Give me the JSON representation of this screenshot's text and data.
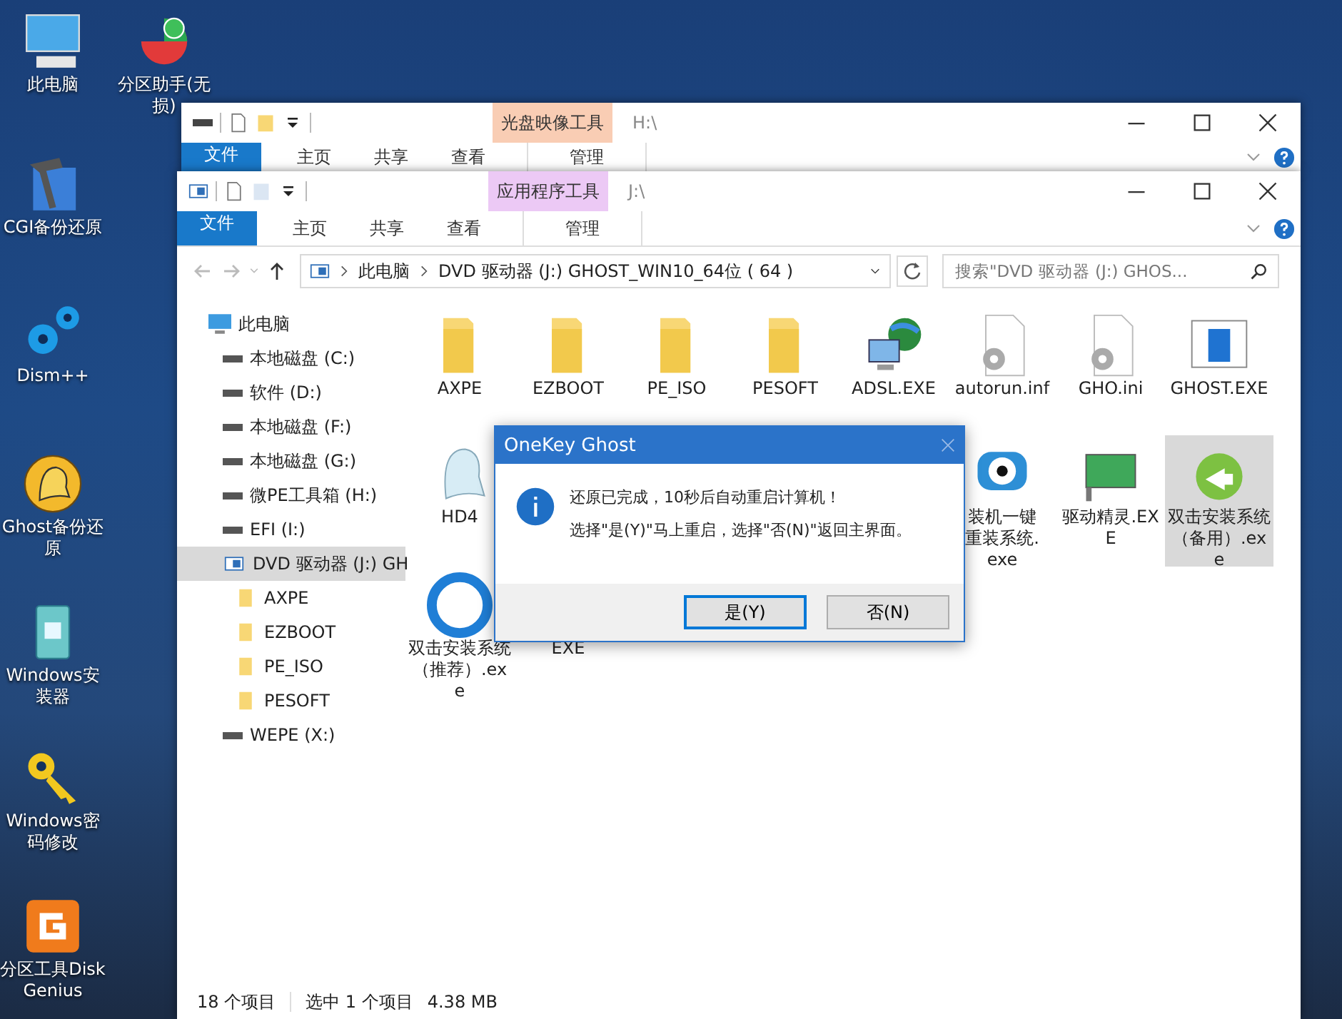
{
  "desktop_icons": [
    {
      "kind": "pc",
      "label": "此电脑"
    },
    {
      "kind": "partition",
      "label": "分区助手(无损)"
    },
    {
      "kind": "cgi",
      "label": "CGI备份还原"
    },
    {
      "kind": "gears",
      "label": "Dism++"
    },
    {
      "kind": "ghost",
      "label": "Ghost备份还原"
    },
    {
      "kind": "installer",
      "label": "Windows安装器"
    },
    {
      "kind": "key",
      "label": "Windows密码修改"
    },
    {
      "kind": "diskgenius",
      "label": "分区工具DiskGenius"
    }
  ],
  "windows": [
    {
      "context_tab": {
        "label": "光盘映像工具",
        "color": "#f9cdb4"
      },
      "path": "H:\\",
      "tabs": [
        {
          "label": "文件",
          "kind": "file"
        },
        {
          "label": "主页",
          "kind": "plain"
        },
        {
          "label": "共享",
          "kind": "plain"
        },
        {
          "label": "查看",
          "kind": "plain"
        },
        {
          "label": "管理",
          "kind": "context"
        }
      ]
    },
    {
      "context_tab": {
        "label": "应用程序工具",
        "color": "#ecc9f5"
      },
      "path": "J:\\",
      "tabs": [
        {
          "label": "文件",
          "kind": "file"
        },
        {
          "label": "主页",
          "kind": "plain"
        },
        {
          "label": "共享",
          "kind": "plain"
        },
        {
          "label": "查看",
          "kind": "plain"
        },
        {
          "label": "管理",
          "kind": "context"
        }
      ],
      "address": {
        "crumbs": [
          "此电脑",
          "DVD 驱动器 (J:) GHOST_WIN10_64位 ( 64 )"
        ],
        "search_placeholder": "搜索\"DVD 驱动器 (J:) GHOS..."
      },
      "nav_tree": [
        {
          "label": "此电脑",
          "kind": "pc",
          "selected": false,
          "children": [
            {
              "label": "本地磁盘 (C:)",
              "kind": "drive",
              "selected": false
            },
            {
              "label": "软件 (D:)",
              "kind": "drive",
              "selected": false
            },
            {
              "label": "本地磁盘 (F:)",
              "kind": "drive",
              "selected": false
            },
            {
              "label": "本地磁盘 (G:)",
              "kind": "drive",
              "selected": false
            },
            {
              "label": "微PE工具箱 (H:)",
              "kind": "drive",
              "selected": false
            },
            {
              "label": "EFI (I:)",
              "kind": "drive",
              "selected": false
            },
            {
              "label": "DVD 驱动器 (J:) GH",
              "kind": "dvd",
              "selected": true,
              "children": [
                {
                  "label": "AXPE",
                  "kind": "folder",
                  "selected": false
                },
                {
                  "label": "EZBOOT",
                  "kind": "folder",
                  "selected": false
                },
                {
                  "label": "PE_ISO",
                  "kind": "folder",
                  "selected": false
                },
                {
                  "label": "PESOFT",
                  "kind": "folder",
                  "selected": false
                }
              ]
            },
            {
              "label": "WEPE (X:)",
              "kind": "drive",
              "selected": false
            }
          ]
        }
      ],
      "files": [
        {
          "label": "AXPE",
          "kind": "folder",
          "selected": false
        },
        {
          "label": "EZBOOT",
          "kind": "folder",
          "selected": false
        },
        {
          "label": "PE_ISO",
          "kind": "folder",
          "selected": false
        },
        {
          "label": "PESOFT",
          "kind": "folder",
          "selected": false
        },
        {
          "label": "ADSL.EXE",
          "kind": "network",
          "selected": false
        },
        {
          "label": "autorun.inf",
          "kind": "config",
          "selected": false
        },
        {
          "label": "GHO.ini",
          "kind": "config",
          "selected": false
        },
        {
          "label": "GHOST.EXE",
          "kind": "window",
          "selected": false
        },
        {
          "label": "HD4",
          "kind": "ghost",
          "selected": false
        },
        {
          "label": "装机一键重装系统.exe",
          "kind": "eye",
          "selected": false
        },
        {
          "label": "驱动精灵.EXE",
          "kind": "card",
          "selected": false
        },
        {
          "label": "双击安装系统（备用）.exe",
          "kind": "install",
          "selected": true
        },
        {
          "label": "双击安装系统（推荐）.exe",
          "kind": "circle",
          "selected": false
        },
        {
          "label": "EXE",
          "kind": "blank",
          "selected": false
        }
      ],
      "status": {
        "count": "18 个项目",
        "selection": "选中 1 个项目",
        "size": "4.38 MB"
      }
    }
  ],
  "dialog": {
    "title": "OneKey Ghost",
    "lines": [
      "还原已完成，10秒后自动重启计算机！",
      "选择\"是(Y)\"马上重启，选择\"否(N)\"返回主界面。"
    ],
    "buttons": [
      {
        "label": "是(Y)",
        "focused": true
      },
      {
        "label": "否(N)",
        "focused": false
      }
    ]
  }
}
